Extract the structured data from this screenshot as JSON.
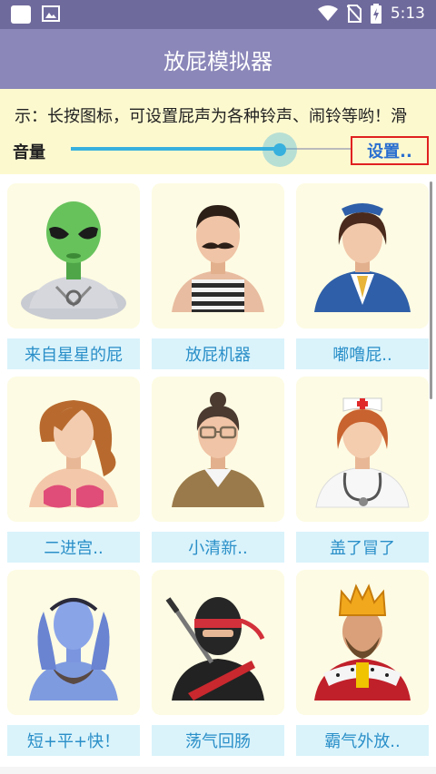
{
  "status_bar": {
    "time": "5:13",
    "icons": [
      "notification-square-icon",
      "image-icon",
      "wifi-icon",
      "no-sim-icon",
      "battery-charging-icon"
    ]
  },
  "app_bar": {
    "title": "放屁模拟器"
  },
  "notice": {
    "text": "示：长按图标，可设置屁声为各种铃声、闹铃等哟！滑"
  },
  "volume": {
    "label": "音量",
    "level": 0.74
  },
  "settings_button": {
    "label": "设置.."
  },
  "items": [
    {
      "label": "来自星星的屁",
      "icon": "alien-avatar-icon"
    },
    {
      "label": "放屁机器",
      "icon": "mustache-man-avatar-icon"
    },
    {
      "label": "嘟噜屁..",
      "icon": "stewardess-avatar-icon"
    },
    {
      "label": "二进宫..",
      "icon": "mermaid-woman-avatar-icon"
    },
    {
      "label": "小清新..",
      "icon": "glasses-woman-avatar-icon"
    },
    {
      "label": "盖了冒了",
      "icon": "nurse-avatar-icon"
    },
    {
      "label": "短+平+快！",
      "icon": "blue-woman-avatar-icon"
    },
    {
      "label": "荡气回肠",
      "icon": "ninja-avatar-icon"
    },
    {
      "label": "霸气外放..",
      "icon": "king-avatar-icon"
    }
  ]
}
